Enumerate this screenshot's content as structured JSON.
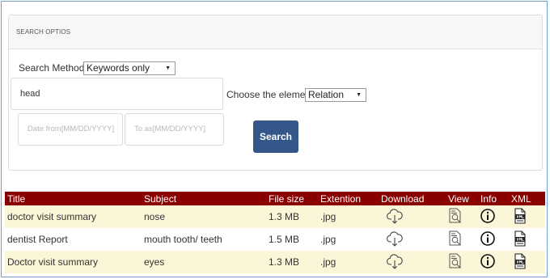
{
  "search": {
    "panel_title": "SEARCH OPTIOS",
    "method_label": "Search Method",
    "method_value": "Keywords only",
    "keyword_value": "head",
    "element_label": "Choose the element:",
    "element_value": "Relation",
    "date_from_placeholder": "Date from[MM/DD/YYYY]",
    "date_to_placeholder": "To as[MM/DD/YYYY]",
    "search_button": "Search"
  },
  "table": {
    "headers": [
      "Title",
      "Subject",
      "File size",
      "Extention",
      "Download",
      "View",
      "Info",
      "XML"
    ],
    "rows": [
      {
        "title": "doctor visit summary",
        "subject": "nose",
        "size": "1.3 MB",
        "ext": ".jpg"
      },
      {
        "title": "dentist Report",
        "subject": "mouth tooth/ teeth",
        "size": "1.5 MB",
        "ext": ".jpg"
      },
      {
        "title": "Doctor visit summary",
        "subject": "eyes",
        "size": "1.3 MB",
        "ext": ".jpg"
      }
    ],
    "icons": {
      "download": "cloud-download-icon",
      "view": "document-search-icon",
      "info": "info-icon",
      "xml": "xml-file-icon"
    }
  }
}
